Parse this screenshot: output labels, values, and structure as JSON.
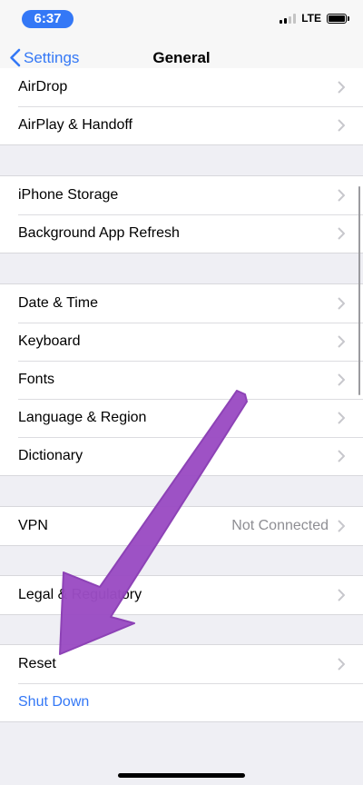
{
  "status_bar": {
    "time": "6:37",
    "network": "LTE"
  },
  "nav": {
    "back_label": "Settings",
    "title": "General"
  },
  "groups": [
    [
      "AirDrop",
      "AirPlay & Handoff"
    ],
    [
      "iPhone Storage",
      "Background App Refresh"
    ],
    [
      "Date & Time",
      "Keyboard",
      "Fonts",
      "Language & Region",
      "Dictionary"
    ],
    [
      "VPN"
    ],
    [
      "Legal & Regulatory"
    ],
    [
      "Reset",
      "Shut Down"
    ]
  ],
  "vpn_status": "Not Connected",
  "colors": {
    "accent": "#3478f6",
    "arrow": "#9b4dc4"
  }
}
